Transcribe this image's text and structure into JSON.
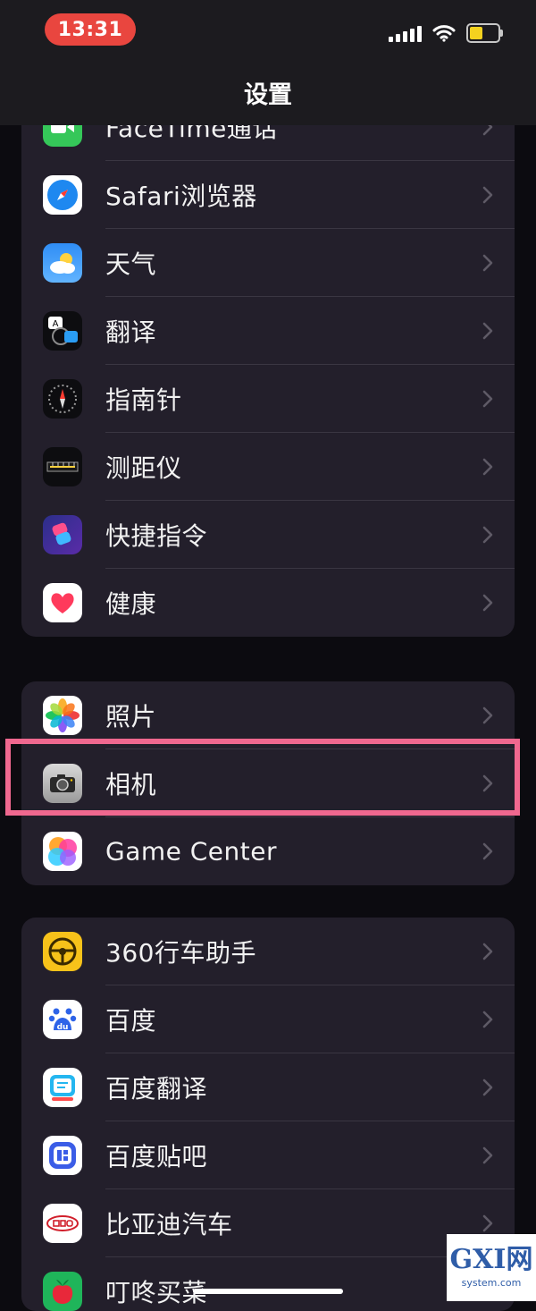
{
  "status": {
    "time": "13:31"
  },
  "nav": {
    "title": "设置"
  },
  "groups": [
    {
      "items": [
        {
          "label": "FaceTime通话",
          "icon": "facetime-icon"
        },
        {
          "label": "Safari浏览器",
          "icon": "safari-icon"
        },
        {
          "label": "天气",
          "icon": "weather-icon"
        },
        {
          "label": "翻译",
          "icon": "translate-icon"
        },
        {
          "label": "指南针",
          "icon": "compass-icon"
        },
        {
          "label": "测距仪",
          "icon": "measure-icon"
        },
        {
          "label": "快捷指令",
          "icon": "shortcuts-icon"
        },
        {
          "label": "健康",
          "icon": "health-icon"
        }
      ]
    },
    {
      "items": [
        {
          "label": "照片",
          "icon": "photos-icon"
        },
        {
          "label": "相机",
          "icon": "camera-icon"
        },
        {
          "label": "Game Center",
          "icon": "game-center-icon"
        }
      ]
    },
    {
      "items": [
        {
          "label": "360行车助手",
          "icon": "360-drive-icon"
        },
        {
          "label": "百度",
          "icon": "baidu-icon"
        },
        {
          "label": "百度翻译",
          "icon": "baidu-translate-icon"
        },
        {
          "label": "百度贴吧",
          "icon": "baidu-tieba-icon"
        },
        {
          "label": "比亚迪汽车",
          "icon": "byd-icon"
        },
        {
          "label": "叮咚买菜",
          "icon": "dingdong-icon"
        }
      ]
    }
  ],
  "watermark": {
    "main": "GXI网",
    "sub": "system.com"
  },
  "colors": {
    "accent_highlight": "#f0688f",
    "status_time_bg": "#e9463f",
    "group_bg": "#231f2b"
  }
}
